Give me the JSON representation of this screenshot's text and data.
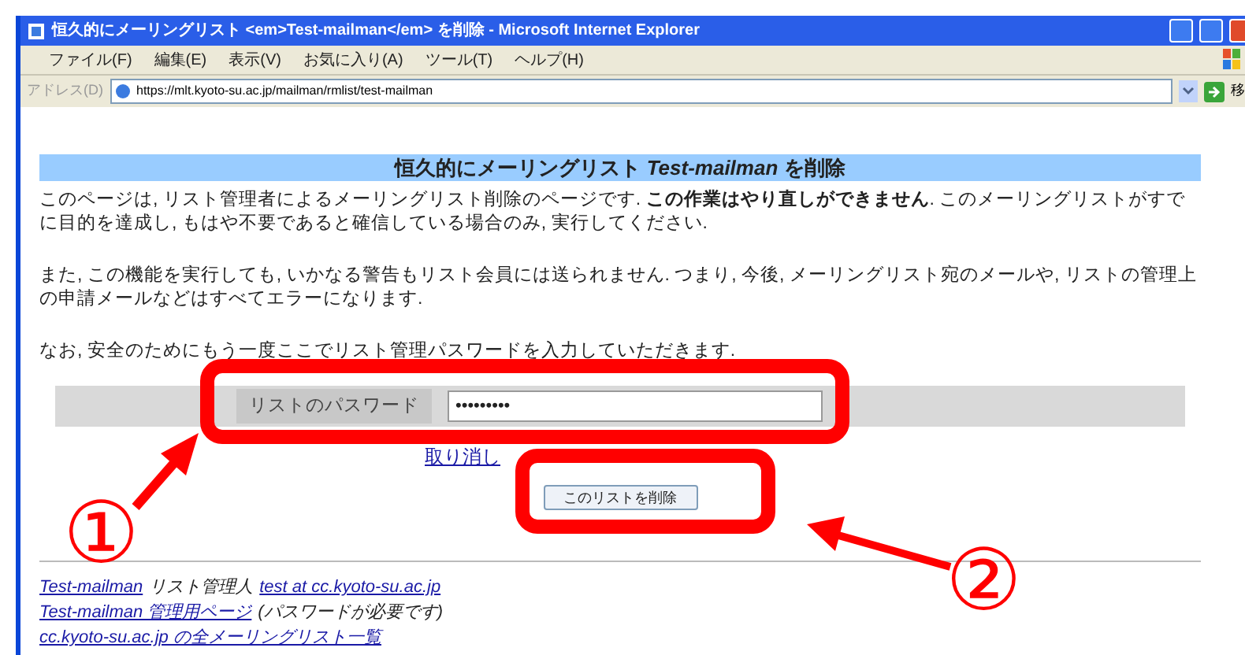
{
  "window": {
    "title": "恒久的にメーリングリスト <em>Test-mailman</em> を削除 - Microsoft Internet Explorer"
  },
  "menu": [
    "ファイル(F)",
    "編集(E)",
    "表示(V)",
    "お気に入り(A)",
    "ツール(T)",
    "ヘルプ(H)"
  ],
  "address_bar": {
    "label": "アドレス(D)",
    "value": "https://mlt.kyoto-su.ac.jp/mailman/rmlist/test-mailman",
    "go": "移"
  },
  "page": {
    "heading": "恒久的にメーリングリスト *Test-mailman* を削除",
    "paragraphs": [
      "このページは, リスト管理者によるメーリングリスト削除のページです. **この作業はやり直しができません**. このメーリングリストがすでに目的を達成し, もはや不要であると確信している場合のみ, 実行してください.",
      "また, この機能を実行しても, いかなる警告もリスト会員には送られません. つまり, 今後, メーリングリスト宛のメールや, リストの管理上の申請メールなどはすべてエラーになります.",
      "なお, 安全のためにもう一度ここでリスト管理パスワードを入力していただきます."
    ],
    "password": {
      "label": "リストのパスワード",
      "value": "•••••••••"
    },
    "cancel_link": "取り消し",
    "delete_button": "このリストを削除",
    "footer": [
      [
        {
          "kind": "link",
          "text": "Test-mailman"
        },
        {
          "kind": "text",
          "text": "リスト管理人"
        },
        {
          "kind": "link",
          "text": "test at cc.kyoto-su.ac.jp"
        }
      ],
      [
        {
          "kind": "link",
          "text": "Test-mailman 管理用ページ"
        },
        {
          "kind": "text",
          "text": "(パスワードが必要です)"
        }
      ],
      [
        {
          "kind": "link",
          "text": "cc.kyoto-su.ac.jp の全メーリングリスト一覧"
        }
      ]
    ]
  },
  "annotations": [
    {
      "label": "①"
    },
    {
      "label": "②"
    }
  ]
}
